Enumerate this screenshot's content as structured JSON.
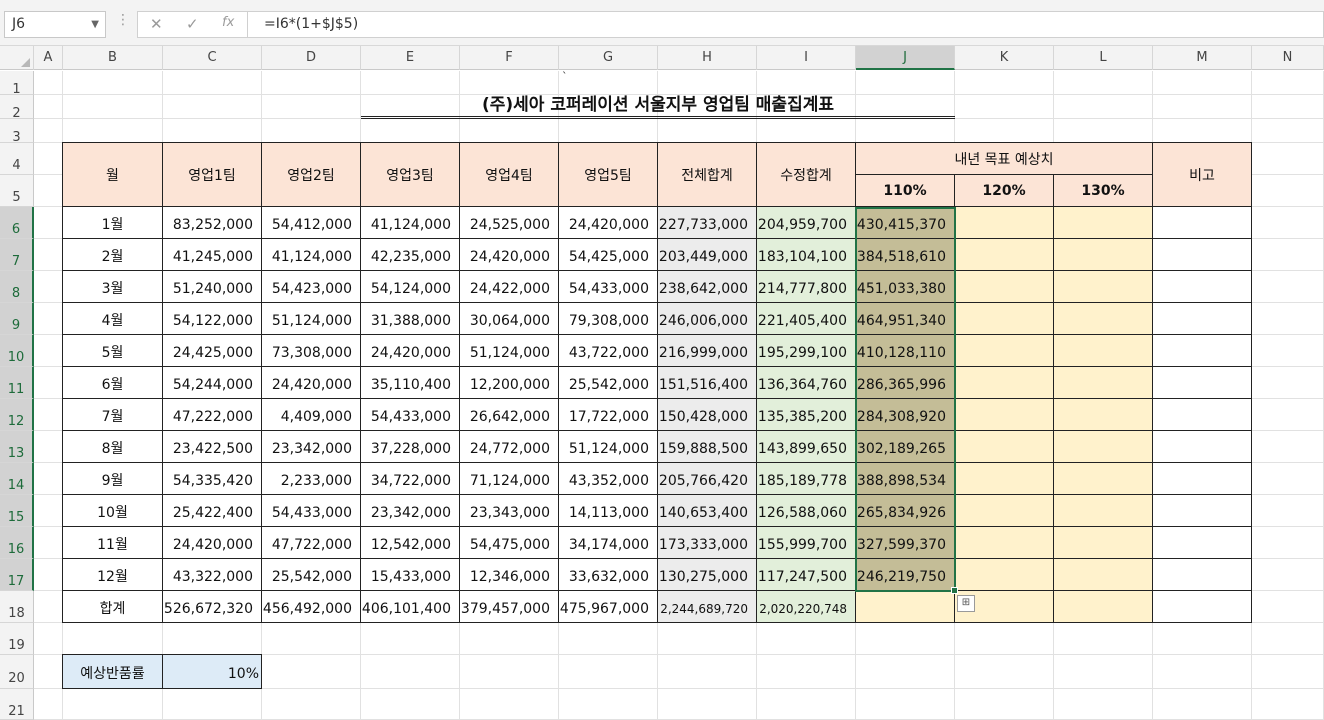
{
  "formula_bar": {
    "name_box": "J6",
    "formula": "=I6*(1+$J$5)",
    "cancel_icon": "x-icon",
    "enter_icon": "check-icon",
    "function_icon": "fx-icon",
    "cancel_glyph": "✕",
    "enter_glyph": "✓",
    "function_glyph": "fx"
  },
  "columns": [
    "A",
    "B",
    "C",
    "D",
    "E",
    "F",
    "G",
    "H",
    "I",
    "J",
    "K",
    "L",
    "M",
    "N"
  ],
  "rows": [
    "1",
    "2",
    "3",
    "4",
    "5",
    "6",
    "7",
    "8",
    "9",
    "10",
    "11",
    "12",
    "13",
    "14",
    "15",
    "16",
    "17",
    "18",
    "19",
    "20",
    "21"
  ],
  "selected_cell": {
    "column": "J",
    "row": "6"
  },
  "stray_mark": "`",
  "sheet": {
    "title": "(주)세아 코퍼레이션 서울지부 영업팀 매출집계표",
    "headers": {
      "month": "월",
      "team1": "영업1팀",
      "team2": "영업2팀",
      "team3": "영업3팀",
      "team4": "영업4팀",
      "team5": "영업5팀",
      "total": "전체합계",
      "adjusted": "수정합계",
      "forecast": "내년 목표 예상치",
      "pct110": "110%",
      "pct120": "120%",
      "pct130": "130%",
      "note": "비고"
    },
    "data_rows": [
      {
        "month": "1월",
        "t1": "83,252,000",
        "t2": "54,412,000",
        "t3": "41,124,000",
        "t4": "24,525,000",
        "t5": "24,420,000",
        "total": "227,733,000",
        "adj": "204,959,700",
        "f110": "430,415,370"
      },
      {
        "month": "2월",
        "t1": "41,245,000",
        "t2": "41,124,000",
        "t3": "42,235,000",
        "t4": "24,420,000",
        "t5": "54,425,000",
        "total": "203,449,000",
        "adj": "183,104,100",
        "f110": "384,518,610"
      },
      {
        "month": "3월",
        "t1": "51,240,000",
        "t2": "54,423,000",
        "t3": "54,124,000",
        "t4": "24,422,000",
        "t5": "54,433,000",
        "total": "238,642,000",
        "adj": "214,777,800",
        "f110": "451,033,380"
      },
      {
        "month": "4월",
        "t1": "54,122,000",
        "t2": "51,124,000",
        "t3": "31,388,000",
        "t4": "30,064,000",
        "t5": "79,308,000",
        "total": "246,006,000",
        "adj": "221,405,400",
        "f110": "464,951,340"
      },
      {
        "month": "5월",
        "t1": "24,425,000",
        "t2": "73,308,000",
        "t3": "24,420,000",
        "t4": "51,124,000",
        "t5": "43,722,000",
        "total": "216,999,000",
        "adj": "195,299,100",
        "f110": "410,128,110"
      },
      {
        "month": "6월",
        "t1": "54,244,000",
        "t2": "24,420,000",
        "t3": "35,110,400",
        "t4": "12,200,000",
        "t5": "25,542,000",
        "total": "151,516,400",
        "adj": "136,364,760",
        "f110": "286,365,996"
      },
      {
        "month": "7월",
        "t1": "47,222,000",
        "t2": "4,409,000",
        "t3": "54,433,000",
        "t4": "26,642,000",
        "t5": "17,722,000",
        "total": "150,428,000",
        "adj": "135,385,200",
        "f110": "284,308,920"
      },
      {
        "month": "8월",
        "t1": "23,422,500",
        "t2": "23,342,000",
        "t3": "37,228,000",
        "t4": "24,772,000",
        "t5": "51,124,000",
        "total": "159,888,500",
        "adj": "143,899,650",
        "f110": "302,189,265"
      },
      {
        "month": "9월",
        "t1": "54,335,420",
        "t2": "2,233,000",
        "t3": "34,722,000",
        "t4": "71,124,000",
        "t5": "43,352,000",
        "total": "205,766,420",
        "adj": "185,189,778",
        "f110": "388,898,534"
      },
      {
        "month": "10월",
        "t1": "25,422,400",
        "t2": "54,433,000",
        "t3": "23,342,000",
        "t4": "23,343,000",
        "t5": "14,113,000",
        "total": "140,653,400",
        "adj": "126,588,060",
        "f110": "265,834,926"
      },
      {
        "month": "11월",
        "t1": "24,420,000",
        "t2": "47,722,000",
        "t3": "12,542,000",
        "t4": "54,475,000",
        "t5": "34,174,000",
        "total": "173,333,000",
        "adj": "155,999,700",
        "f110": "327,599,370"
      },
      {
        "month": "12월",
        "t1": "43,322,000",
        "t2": "25,542,000",
        "t3": "15,433,000",
        "t4": "12,346,000",
        "t5": "33,632,000",
        "total": "130,275,000",
        "adj": "117,247,500",
        "f110": "246,219,750"
      }
    ],
    "total_row": {
      "label": "합계",
      "t1": "526,672,320",
      "t2": "456,492,000",
      "t3": "406,101,400",
      "t4": "379,457,000",
      "t5": "475,967,000",
      "total": "2,244,689,720",
      "adj": "2,020,220,748"
    },
    "return_rate": {
      "label": "예상반품률",
      "value": "10%"
    }
  },
  "colors": {
    "header_fill": "#fce4d6",
    "total_fill": "#ececec",
    "adjusted_fill": "#e2efda",
    "forecast_fill": "#c4bd97",
    "empty_forecast_fill": "#fff2cc",
    "rate_fill": "#ddebf7",
    "selection": "#217346"
  }
}
